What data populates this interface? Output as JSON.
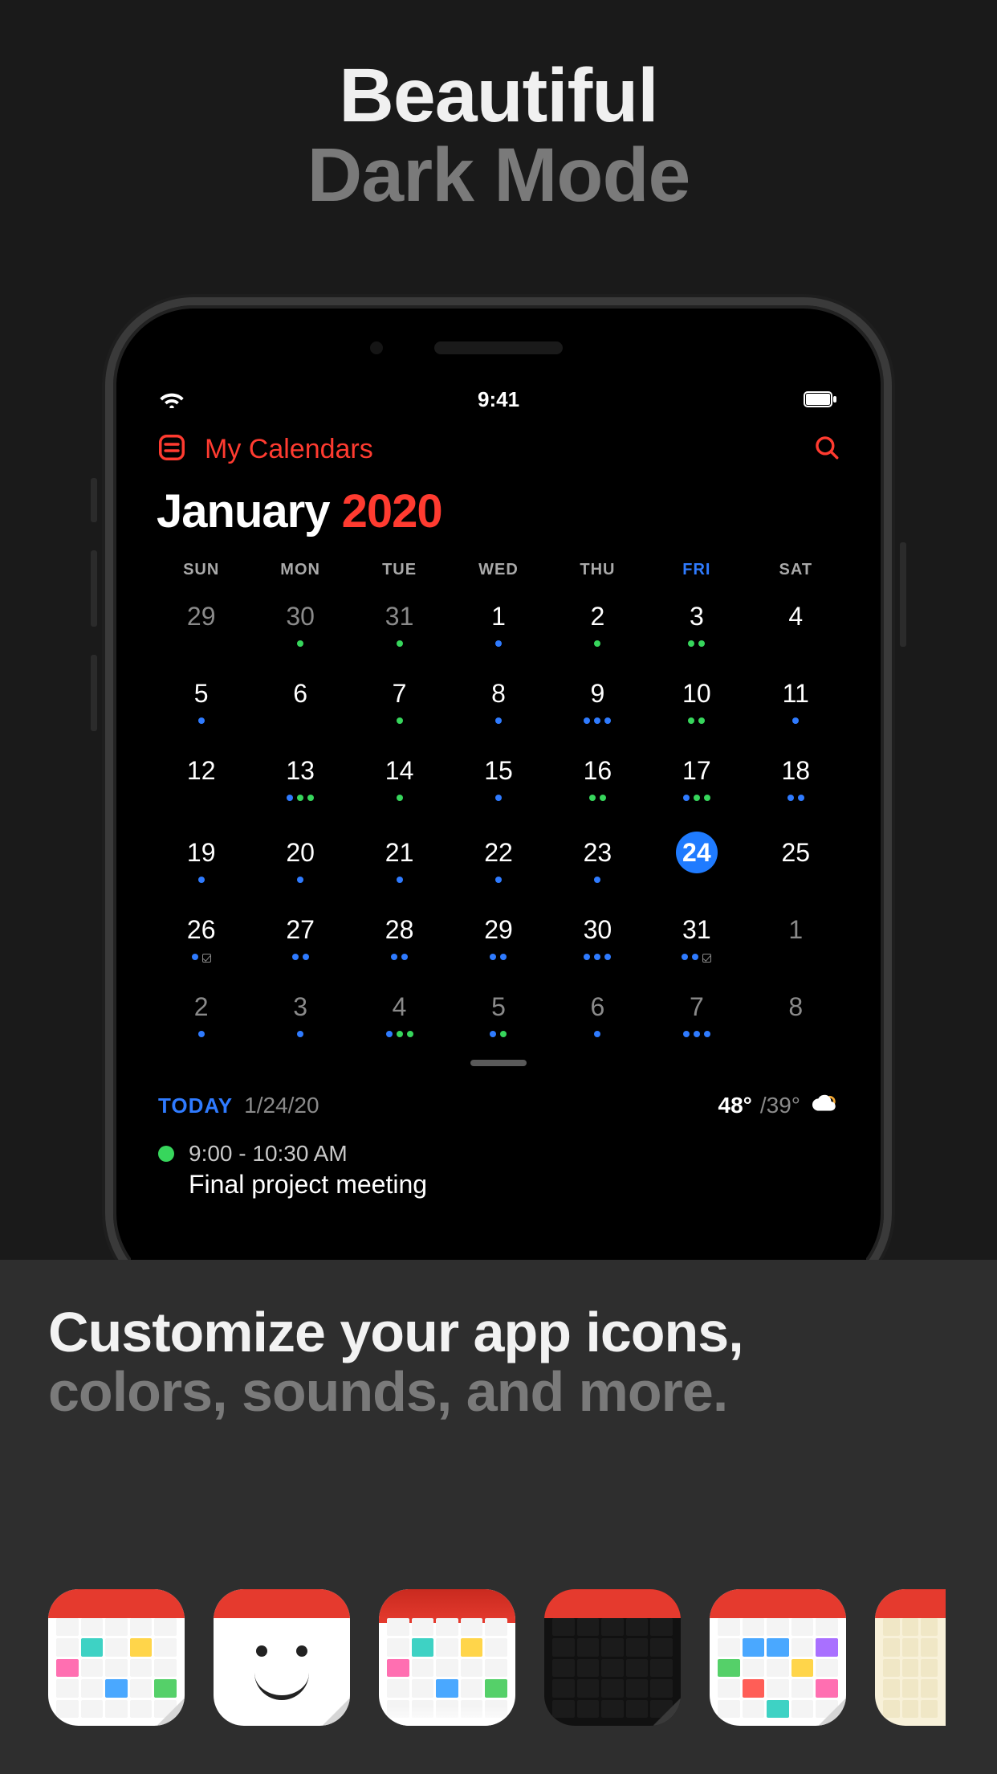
{
  "hero": {
    "line1": "Beautiful",
    "line2": "Dark Mode"
  },
  "status": {
    "time": "9:41"
  },
  "nav": {
    "title": "My Calendars"
  },
  "month": {
    "name": "January",
    "year": "2020"
  },
  "weekdays": [
    "SUN",
    "MON",
    "TUE",
    "WED",
    "THU",
    "FRI",
    "SAT"
  ],
  "calendar": {
    "weeks": [
      {
        "days": [
          {
            "n": "29",
            "dim": true,
            "dots": []
          },
          {
            "n": "30",
            "dim": true,
            "dots": [
              "green"
            ]
          },
          {
            "n": "31",
            "dim": true,
            "dots": [
              "green"
            ]
          },
          {
            "n": "1",
            "dots": [
              "blue"
            ]
          },
          {
            "n": "2",
            "dots": [
              "green"
            ]
          },
          {
            "n": "3",
            "dots": [
              "green",
              "green"
            ]
          },
          {
            "n": "4",
            "dots": []
          }
        ]
      },
      {
        "days": [
          {
            "n": "5",
            "dots": [
              "blue"
            ]
          },
          {
            "n": "6",
            "dots": []
          },
          {
            "n": "7",
            "dots": [
              "green"
            ]
          },
          {
            "n": "8",
            "dots": [
              "blue"
            ]
          },
          {
            "n": "9",
            "dots": [
              "blue",
              "blue",
              "blue"
            ]
          },
          {
            "n": "10",
            "dots": [
              "green",
              "green"
            ]
          },
          {
            "n": "11",
            "dots": [
              "blue"
            ]
          }
        ]
      },
      {
        "days": [
          {
            "n": "12",
            "dots": []
          },
          {
            "n": "13",
            "dots": [
              "blue",
              "green",
              "green"
            ]
          },
          {
            "n": "14",
            "dots": [
              "green"
            ]
          },
          {
            "n": "15",
            "dots": [
              "blue"
            ]
          },
          {
            "n": "16",
            "dots": [
              "green",
              "green"
            ]
          },
          {
            "n": "17",
            "dots": [
              "blue",
              "green",
              "green"
            ]
          },
          {
            "n": "18",
            "dots": [
              "blue",
              "blue"
            ]
          }
        ]
      },
      {
        "highlight": true,
        "days": [
          {
            "n": "19",
            "dots": [
              "blue"
            ]
          },
          {
            "n": "20",
            "dots": [
              "blue"
            ]
          },
          {
            "n": "21",
            "dots": [
              "blue"
            ]
          },
          {
            "n": "22",
            "dots": [
              "blue"
            ]
          },
          {
            "n": "23",
            "dots": [
              "blue"
            ]
          },
          {
            "n": "24",
            "selected": true,
            "dots": []
          },
          {
            "n": "25",
            "dots": []
          }
        ]
      },
      {
        "days": [
          {
            "n": "26",
            "dots": [
              "blue",
              "chk"
            ]
          },
          {
            "n": "27",
            "dots": [
              "blue",
              "blue"
            ]
          },
          {
            "n": "28",
            "dots": [
              "blue",
              "blue"
            ]
          },
          {
            "n": "29",
            "dots": [
              "blue",
              "blue"
            ]
          },
          {
            "n": "30",
            "dots": [
              "blue",
              "blue",
              "blue"
            ]
          },
          {
            "n": "31",
            "dots": [
              "blue",
              "blue",
              "chk"
            ]
          },
          {
            "n": "1",
            "dim": true,
            "dots": []
          }
        ]
      },
      {
        "days": [
          {
            "n": "2",
            "dim": true,
            "dots": [
              "blue"
            ]
          },
          {
            "n": "3",
            "dim": true,
            "dots": [
              "blue"
            ]
          },
          {
            "n": "4",
            "dim": true,
            "dots": [
              "blue",
              "green",
              "green"
            ]
          },
          {
            "n": "5",
            "dim": true,
            "dots": [
              "blue",
              "green"
            ]
          },
          {
            "n": "6",
            "dim": true,
            "dots": [
              "blue"
            ]
          },
          {
            "n": "7",
            "dim": true,
            "dots": [
              "blue",
              "blue",
              "blue"
            ]
          },
          {
            "n": "8",
            "dim": true,
            "dots": []
          }
        ]
      }
    ]
  },
  "today": {
    "label": "TODAY",
    "date": "1/24/20",
    "temp_hi": "48°",
    "temp_lo": "/39°"
  },
  "event": {
    "time": "9:00 - 10:30 AM",
    "title": "Final project meeting",
    "color": "#37d65c"
  },
  "promo": {
    "line1": "Customize your app icons,",
    "line2": "colors, sounds, and more."
  },
  "app_icons": [
    "classic",
    "face",
    "frosted",
    "dark",
    "bright",
    "sepia"
  ]
}
